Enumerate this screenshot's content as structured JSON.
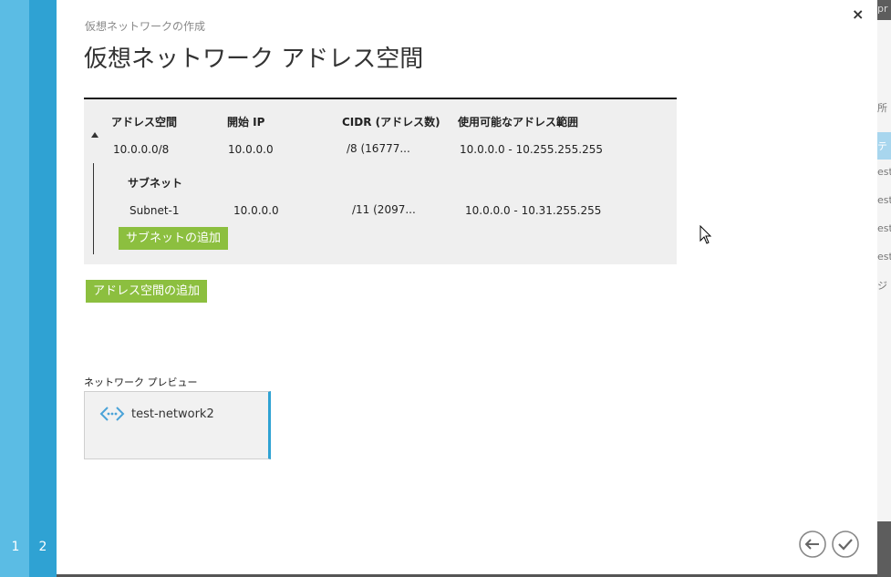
{
  "wizard": {
    "steps": [
      "1",
      "2"
    ],
    "subtitle": "仮想ネットワークの作成",
    "title": "仮想ネットワーク アドレス空間",
    "close_label": "×"
  },
  "table": {
    "headers": [
      "アドレス空間",
      "開始 IP",
      "CIDR (アドレス数)",
      "使用可能なアドレス範囲"
    ],
    "address_space": {
      "address": "10.0.0.0/8",
      "start_ip": "10.0.0.0",
      "cidr": "/8 (16777...",
      "range": "10.0.0.0 - 10.255.255.255"
    },
    "subnet_header": "サブネット",
    "subnets": [
      {
        "name": "Subnet-1",
        "start_ip": "10.0.0.0",
        "cidr": "/11 (2097...",
        "range": "10.0.0.0 - 10.31.255.255"
      }
    ],
    "add_subnet_label": "サブネットの追加"
  },
  "add_address_space_label": "アドレス空間の追加",
  "preview": {
    "label": "ネットワーク プレビュー",
    "network_name": "test-network2",
    "icon": "virtual-network-icon"
  },
  "navigation": {
    "back_icon": "arrow-left-icon",
    "confirm_icon": "checkmark-icon"
  },
  "background_portal": {
    "fragments": [
      "pr",
      "所",
      "テ",
      "est",
      "est",
      "est",
      "est",
      "ジ"
    ]
  },
  "colors": {
    "rail_light": "#5bbce4",
    "rail_dark": "#2fa2d3",
    "button_green": "#8cbf3f",
    "table_bg": "#efefef"
  }
}
